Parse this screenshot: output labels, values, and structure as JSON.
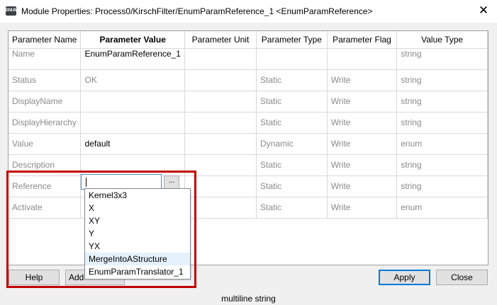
{
  "window": {
    "app_icon_text": "ENUM",
    "title": "Module Properties: Process0/KirschFilter/EnumParamReference_1 <EnumParamReference>",
    "close_glyph": "✕"
  },
  "grid": {
    "columns": [
      "Parameter Name",
      "Parameter Value",
      "Parameter Unit",
      "Parameter Type",
      "Parameter Flag",
      "Value Type"
    ],
    "rows": [
      {
        "name": "Name",
        "value": "EnumParamReference_1",
        "unit": "",
        "type": "",
        "flag": "",
        "vtype": "string"
      },
      {
        "name": "Status",
        "value": "OK",
        "unit": "",
        "type": "Static",
        "flag": "Write",
        "vtype": "string"
      },
      {
        "name": "DisplayName",
        "value": "",
        "unit": "",
        "type": "Static",
        "flag": "Write",
        "vtype": "string"
      },
      {
        "name": "DisplayHierarchy",
        "value": "",
        "unit": "",
        "type": "Static",
        "flag": "Write",
        "vtype": "string"
      },
      {
        "name": "Value",
        "value": "default",
        "unit": "",
        "type": "Dynamic",
        "flag": "Write",
        "vtype": "enum"
      },
      {
        "name": "Description",
        "value": "",
        "unit": "",
        "type": "Static",
        "flag": "Write",
        "vtype": "string"
      },
      {
        "name": "Reference",
        "value": "",
        "unit": "",
        "type": "Static",
        "flag": "Write",
        "vtype": "string"
      },
      {
        "name": "Activate",
        "value": "",
        "unit": "",
        "type": "Static",
        "flag": "Write",
        "vtype": "enum"
      }
    ]
  },
  "editor": {
    "ellipsis_label": "...",
    "options": [
      "Kernel3x3",
      "X",
      "XY",
      "Y",
      "YX",
      "MergeIntoAStructure",
      "EnumParamTranslator_1"
    ],
    "highlighted": "MergeIntoAStructure"
  },
  "buttons": {
    "help": "Help",
    "add": "Add",
    "apply": "Apply",
    "close": "Close"
  },
  "status_text": "multiline string",
  "colors": {
    "highlight_frame": "#c00000",
    "focus_border": "#0078d7"
  }
}
